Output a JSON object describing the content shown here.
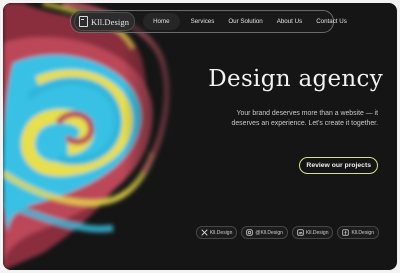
{
  "nav": {
    "brand": "Kll.Design",
    "items": [
      {
        "label": "Home",
        "active": true
      },
      {
        "label": "Services",
        "active": false
      },
      {
        "label": "Our Solution",
        "active": false
      },
      {
        "label": "About Us",
        "active": false
      },
      {
        "label": "Contact Us",
        "active": false
      }
    ]
  },
  "hero": {
    "title": "Design agency",
    "subtitle": "Your brand deserves more than a website — it deserves an experience. Let's create it together.",
    "cta": "Review our projects"
  },
  "socials": [
    {
      "icon": "x-icon",
      "label": "Kll.Design"
    },
    {
      "icon": "instagram-icon",
      "label": "@Kll.Design"
    },
    {
      "icon": "linkedin-icon",
      "label": "Kll.Design"
    },
    {
      "icon": "facebook-icon",
      "label": "Kll.Design"
    }
  ],
  "colors": {
    "background": "#151515",
    "accent_border": "#d3e08a",
    "swirl_colors": [
      "#2ec4e6",
      "#e8e04a",
      "#b03a4a",
      "#c85a6a"
    ]
  }
}
